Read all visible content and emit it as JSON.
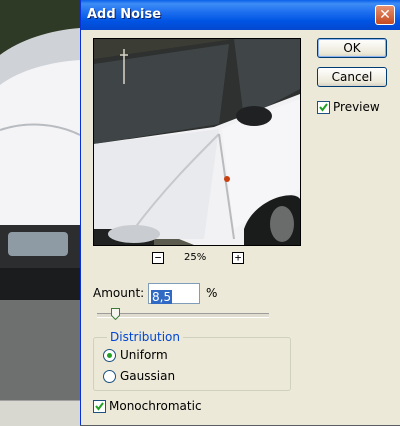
{
  "dialog": {
    "title": "Add Noise",
    "close_glyph": "✕",
    "ok_label": "OK",
    "cancel_label": "Cancel",
    "preview_label": "Preview",
    "preview_checked": true
  },
  "zoom": {
    "minus": "−",
    "plus": "+",
    "level": "25%"
  },
  "amount": {
    "label": "Amount:",
    "value": "8,5",
    "unit": "%",
    "slider_fraction": 0.085
  },
  "distribution": {
    "title": "Distribution",
    "options": [
      "Uniform",
      "Gaussian"
    ],
    "selected": "Uniform"
  },
  "monochromatic": {
    "label": "Monochromatic",
    "checked": true
  },
  "colors": {
    "titlebar": "#0054e3",
    "dialog_bg": "#ece9d8",
    "selection": "#316ac5",
    "group_title": "#0046d5",
    "check_green": "#21a121"
  },
  "icons": {
    "close": "close-icon",
    "check": "check-icon",
    "zoom_out": "minus-icon",
    "zoom_in": "plus-icon"
  }
}
